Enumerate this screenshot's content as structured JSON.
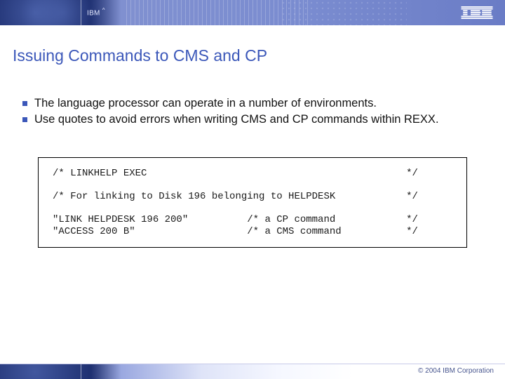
{
  "header": {
    "brand_small": "IBM",
    "caret": "^"
  },
  "title": "Issuing Commands to CMS and CP",
  "bullets": [
    "The language processor can operate in a number of environments.",
    "Use quotes to avoid errors when writing CMS and CP commands within REXX."
  ],
  "code": "/* LINKHELP EXEC                                            */\n\n/* For linking to Disk 196 belonging to HELPDESK            */\n\n\"LINK HELPDESK 196 200\"          /* a CP command            */\n\"ACCESS 200 B\"                   /* a CMS command           */",
  "footer": {
    "copyright": "© 2004 IBM Corporation"
  }
}
